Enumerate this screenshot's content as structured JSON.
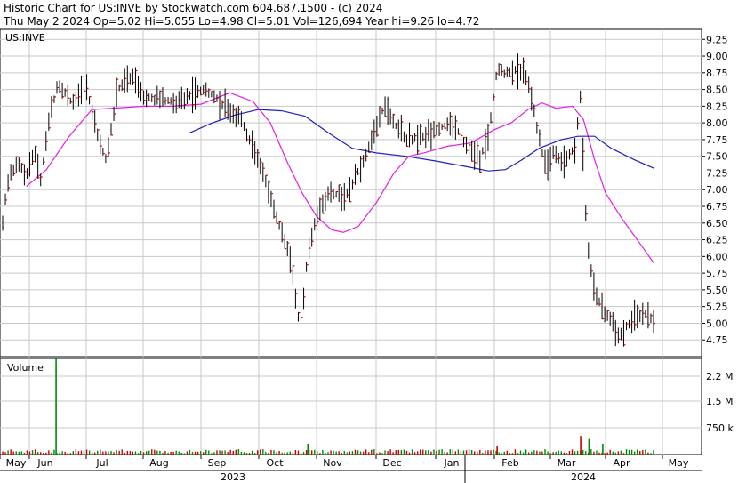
{
  "header": {
    "line1": "Historic Chart for US:INVE by Stockwatch.com 604.687.1500 - (c) 2024",
    "line2": "Thu May  2 2024  Op=5.02  Hi=5.055  Lo=4.98  Cl=5.01  Vol=126,694  Year hi=9.26  lo=4.72"
  },
  "chart_data": {
    "type": "candlestick",
    "symbol": "US:INVE",
    "price_axis": {
      "range": [
        4.5,
        9.4
      ],
      "ticks": [
        "9.25",
        "9.00",
        "8.75",
        "8.50",
        "8.25",
        "8.00",
        "7.75",
        "7.50",
        "7.25",
        "7.00",
        "6.75",
        "6.50",
        "6.25",
        "6.00",
        "5.75",
        "5.50",
        "5.25",
        "5.00",
        "4.75"
      ]
    },
    "volume_panel": {
      "label": "Volume",
      "ticks": [
        "2.2 M",
        "1.5 M",
        "750 k"
      ],
      "range": [
        0,
        2700000
      ],
      "spike": {
        "month_index": 1.47,
        "value": 2700000
      }
    },
    "months": [
      "May",
      "Jun",
      "Jul",
      "Aug",
      "Sep",
      "Oct",
      "Nov",
      "Dec",
      "Jan",
      "Feb",
      "Mar",
      "Apr",
      "May"
    ],
    "years": [
      "2023",
      "2024"
    ],
    "price_path": [
      [
        0.0,
        5.2
      ],
      [
        0.1,
        6.6
      ],
      [
        0.3,
        7.2
      ],
      [
        0.6,
        7.4
      ],
      [
        0.9,
        7.2
      ],
      [
        1.1,
        7.55
      ],
      [
        1.2,
        7.15
      ],
      [
        1.35,
        8.05
      ],
      [
        1.5,
        8.6
      ],
      [
        1.75,
        8.3
      ],
      [
        2.0,
        8.55
      ],
      [
        2.2,
        7.8
      ],
      [
        2.35,
        7.45
      ],
      [
        2.55,
        8.5
      ],
      [
        2.8,
        8.7
      ],
      [
        3.0,
        8.4
      ],
      [
        3.3,
        8.35
      ],
      [
        3.6,
        8.3
      ],
      [
        3.9,
        8.45
      ],
      [
        4.1,
        8.5
      ],
      [
        4.4,
        8.25
      ],
      [
        4.7,
        8.05
      ],
      [
        4.9,
        7.6
      ],
      [
        5.1,
        7.2
      ],
      [
        5.3,
        6.6
      ],
      [
        5.55,
        6.0
      ],
      [
        5.65,
        5.3
      ],
      [
        5.72,
        4.85
      ],
      [
        5.85,
        6.1
      ],
      [
        6.0,
        6.6
      ],
      [
        6.2,
        6.95
      ],
      [
        6.5,
        6.9
      ],
      [
        6.8,
        7.45
      ],
      [
        7.0,
        7.9
      ],
      [
        7.15,
        8.3
      ],
      [
        7.3,
        8.0
      ],
      [
        7.5,
        7.75
      ],
      [
        7.8,
        7.8
      ],
      [
        8.0,
        7.9
      ],
      [
        8.3,
        8.0
      ],
      [
        8.5,
        7.7
      ],
      [
        8.75,
        7.45
      ],
      [
        8.9,
        7.8
      ],
      [
        9.05,
        8.8
      ],
      [
        9.2,
        8.75
      ],
      [
        9.4,
        8.8
      ],
      [
        9.6,
        8.65
      ],
      [
        9.75,
        8.0
      ],
      [
        9.9,
        7.35
      ],
      [
        10.05,
        7.55
      ],
      [
        10.25,
        7.4
      ],
      [
        10.45,
        7.65
      ],
      [
        10.55,
        8.45
      ],
      [
        10.62,
        6.85
      ],
      [
        10.7,
        6.0
      ],
      [
        10.8,
        5.5
      ],
      [
        10.95,
        5.2
      ],
      [
        11.1,
        5.05
      ],
      [
        11.25,
        4.8
      ],
      [
        11.4,
        5.0
      ],
      [
        11.55,
        5.1
      ],
      [
        11.7,
        5.15
      ],
      [
        11.85,
        5.05
      ]
    ],
    "moving_averages": [
      {
        "color": "#e020e0",
        "points": [
          [
            0.9,
            7.05
          ],
          [
            1.3,
            7.3
          ],
          [
            1.7,
            7.8
          ],
          [
            2.1,
            8.2
          ],
          [
            2.5,
            8.22
          ],
          [
            3.0,
            8.25
          ],
          [
            3.5,
            8.25
          ],
          [
            4.0,
            8.28
          ],
          [
            4.5,
            8.45
          ],
          [
            4.9,
            8.32
          ],
          [
            5.2,
            8.0
          ],
          [
            5.5,
            7.4
          ],
          [
            5.75,
            6.95
          ],
          [
            6.0,
            6.6
          ],
          [
            6.25,
            6.4
          ],
          [
            6.45,
            6.36
          ],
          [
            6.7,
            6.45
          ],
          [
            7.0,
            6.8
          ],
          [
            7.3,
            7.25
          ],
          [
            7.55,
            7.5
          ],
          [
            7.8,
            7.55
          ],
          [
            8.2,
            7.65
          ],
          [
            8.6,
            7.7
          ],
          [
            9.0,
            7.9
          ],
          [
            9.3,
            8.0
          ],
          [
            9.6,
            8.2
          ],
          [
            9.85,
            8.3
          ],
          [
            10.1,
            8.22
          ],
          [
            10.4,
            8.25
          ],
          [
            10.6,
            8.05
          ],
          [
            10.8,
            7.45
          ],
          [
            11.0,
            6.95
          ],
          [
            11.3,
            6.55
          ],
          [
            11.6,
            6.2
          ],
          [
            11.85,
            5.9
          ]
        ]
      },
      {
        "color": "#2020c0",
        "points": [
          [
            3.8,
            7.85
          ],
          [
            4.2,
            8.0
          ],
          [
            4.6,
            8.12
          ],
          [
            5.0,
            8.2
          ],
          [
            5.4,
            8.18
          ],
          [
            5.8,
            8.1
          ],
          [
            6.2,
            7.85
          ],
          [
            6.6,
            7.62
          ],
          [
            7.0,
            7.55
          ],
          [
            7.5,
            7.5
          ],
          [
            8.0,
            7.43
          ],
          [
            8.5,
            7.35
          ],
          [
            8.9,
            7.28
          ],
          [
            9.2,
            7.3
          ],
          [
            9.5,
            7.45
          ],
          [
            9.8,
            7.62
          ],
          [
            10.2,
            7.75
          ],
          [
            10.5,
            7.8
          ],
          [
            10.8,
            7.8
          ],
          [
            11.1,
            7.62
          ],
          [
            11.5,
            7.45
          ],
          [
            11.85,
            7.32
          ]
        ]
      }
    ],
    "volume_accents": [
      {
        "month_index": 1.47,
        "color": "#008800",
        "value": 2700000
      },
      {
        "month_index": 10.55,
        "color": "#cc0000",
        "value": 520000
      },
      {
        "month_index": 10.7,
        "color": "#008800",
        "value": 460000
      },
      {
        "month_index": 10.95,
        "color": "#008800",
        "value": 300000
      },
      {
        "month_index": 5.85,
        "color": "#008800",
        "value": 300000
      },
      {
        "month_index": 9.05,
        "color": "#cc0000",
        "value": 250000
      }
    ],
    "grid": true
  }
}
